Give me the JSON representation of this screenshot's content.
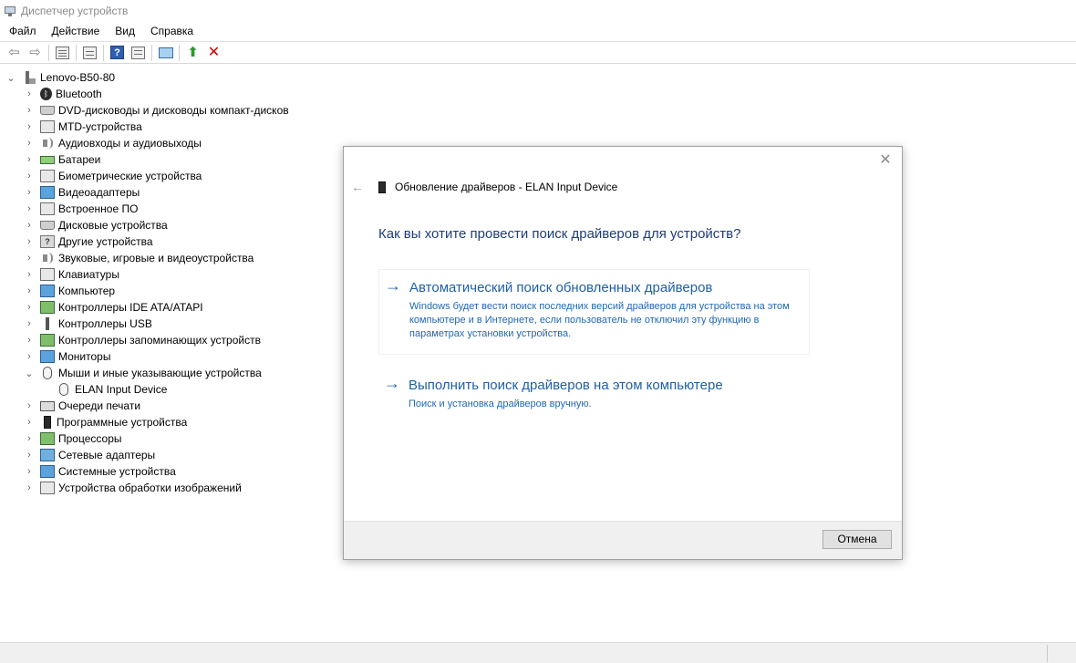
{
  "window": {
    "title": "Диспетчер устройств"
  },
  "menu": [
    "Файл",
    "Действие",
    "Вид",
    "Справка"
  ],
  "toolbar": {
    "icons": [
      "back-arrow",
      "forward-arrow",
      "properties",
      "show-hide",
      "help",
      "scan-hardware",
      "monitor",
      "update-driver",
      "uninstall-device"
    ]
  },
  "tree": {
    "root": "Lenovo-B50-80",
    "categories": [
      {
        "label": "Bluetooth",
        "icon": "bluetooth"
      },
      {
        "label": "DVD-дисководы и дисководы компакт-дисков",
        "icon": "disk"
      },
      {
        "label": "MTD-устройства",
        "icon": "plain"
      },
      {
        "label": "Аудиовходы и аудиовыходы",
        "icon": "speaker"
      },
      {
        "label": "Батареи",
        "icon": "battery"
      },
      {
        "label": "Биометрические устройства",
        "icon": "plain"
      },
      {
        "label": "Видеоадаптеры",
        "icon": "screen"
      },
      {
        "label": "Встроенное ПО",
        "icon": "plain"
      },
      {
        "label": "Дисковые устройства",
        "icon": "disk"
      },
      {
        "label": "Другие устройства",
        "icon": "question"
      },
      {
        "label": "Звуковые, игровые и видеоустройства",
        "icon": "speaker"
      },
      {
        "label": "Клавиатуры",
        "icon": "plain"
      },
      {
        "label": "Компьютер",
        "icon": "screen"
      },
      {
        "label": "Контроллеры IDE ATA/ATAPI",
        "icon": "chip"
      },
      {
        "label": "Контроллеры USB",
        "icon": "usb"
      },
      {
        "label": "Контроллеры запоминающих устройств",
        "icon": "chip"
      },
      {
        "label": "Мониторы",
        "icon": "screen"
      },
      {
        "label": "Мыши и иные указывающие устройства",
        "icon": "mouse",
        "expanded": true,
        "children": [
          "ELAN Input Device"
        ]
      },
      {
        "label": "Очереди печати",
        "icon": "printer"
      },
      {
        "label": "Программные устройства",
        "icon": "phone"
      },
      {
        "label": "Процессоры",
        "icon": "chip"
      },
      {
        "label": "Сетевые адаптеры",
        "icon": "net"
      },
      {
        "label": "Системные устройства",
        "icon": "screen"
      },
      {
        "label": "Устройства обработки изображений",
        "icon": "plain"
      }
    ]
  },
  "dialog": {
    "header": "Обновление драйверов - ELAN Input Device",
    "question": "Как вы хотите провести поиск драйверов для устройств?",
    "option_auto": {
      "title": "Автоматический поиск обновленных драйверов",
      "desc": "Windows будет вести поиск последних версий драйверов для устройства на этом компьютере и в Интернете, если пользователь не отключил эту функцию в параметрах установки устройства."
    },
    "option_manual": {
      "title": "Выполнить поиск драйверов на этом компьютере",
      "desc": "Поиск и установка драйверов вручную."
    },
    "cancel": "Отмена"
  }
}
